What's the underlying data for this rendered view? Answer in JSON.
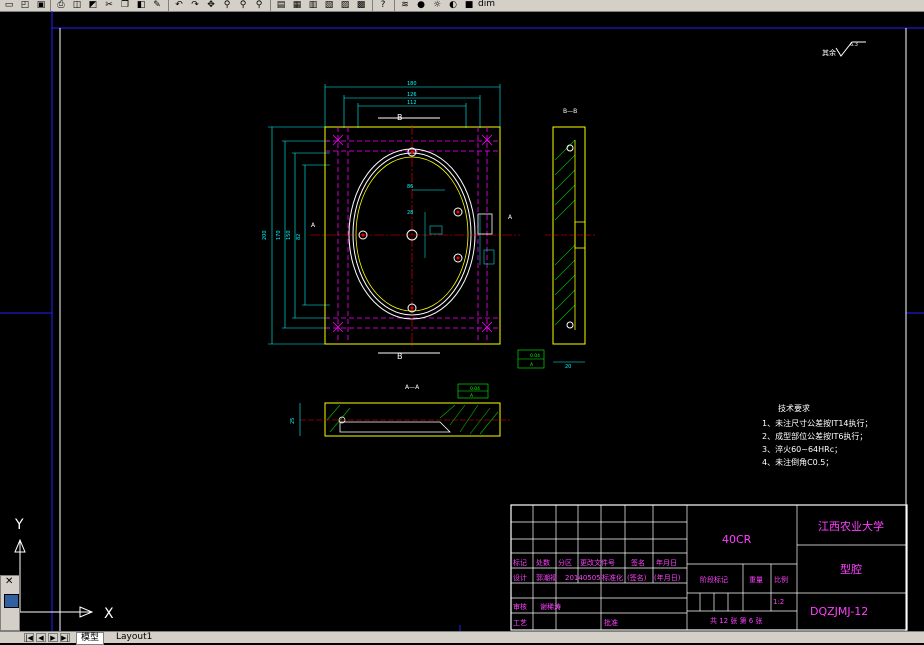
{
  "toolbar": {
    "layer_name": "dim",
    "icons": [
      "new-icon",
      "open-icon",
      "save-icon",
      "print-icon",
      "preview-icon",
      "publish-icon",
      "cut-icon",
      "copy-icon",
      "paste-icon",
      "match-icon",
      "undo-icon",
      "redo-icon",
      "pan-icon",
      "zoom-realtime-icon",
      "zoom-window-icon",
      "zoom-previous-icon",
      "properties-icon",
      "design-center-icon",
      "tool-palette-icon",
      "sheet-set-icon",
      "markup-icon",
      "calc-icon",
      "help-icon",
      "layer-icon",
      "light-icon",
      "freeze-icon",
      "lock-icon",
      "color-icon"
    ]
  },
  "drawing": {
    "roughness_note": "其余",
    "roughness_symbol": "6.3",
    "section_bb": "B—B",
    "section_aa": "A—A",
    "label_b_top": "B",
    "label_b_bottom": "B",
    "label_a_left": "A",
    "label_a_right": "A",
    "dims": {
      "top1": "180",
      "top2": "126",
      "top3": "112",
      "top4": "100",
      "left1": "200",
      "left2": "170",
      "left3": "150",
      "left4": "82",
      "left5": "62",
      "center1": "86",
      "center2": "28",
      "section_w": "20",
      "aa_h": "25"
    },
    "tolerance_bb": [
      "0.04",
      "A"
    ],
    "tolerance_aa": [
      "0.04",
      "A"
    ],
    "tech_title": "技术要求",
    "tech_items": [
      "1、未注尺寸公差按IT14执行；",
      "2、成型部位公差按IT6执行；",
      "3、淬火60~64HRc；",
      "4、未注倒角C0.5；"
    ]
  },
  "title_block": {
    "material": "40CR",
    "school": "江西农业大学",
    "part_name": "型腔",
    "drawing_no": "DQZJMJ-12",
    "scale": "1:2",
    "sheets": "共 12 张 第 6 张",
    "header_row": [
      "标记",
      "处数",
      "分区",
      "更改文件号",
      "签名",
      "年月日"
    ],
    "design_row": [
      "设计",
      "郭潮福",
      "20140505",
      "标准化",
      "(签名)",
      "(年月日)"
    ],
    "stage_label": "阶段标记",
    "weight_label": "重量",
    "scale_label": "比例",
    "review_label": "审核",
    "review_name": "谢稀涛",
    "process_label": "工艺",
    "approve_label": "批准"
  },
  "ucs": {
    "x": "X",
    "y": "Y"
  },
  "tabs": {
    "model": "模型",
    "layout1": "Layout1"
  },
  "colors": {
    "outline": "#ffff00",
    "dimension": "#00ffff",
    "center": "#ff0000",
    "hidden": "#ff00ff",
    "hatch": "#00c000",
    "annot": "#ffffff",
    "titleblock": "#ff40ff",
    "border": "#0000ff"
  }
}
